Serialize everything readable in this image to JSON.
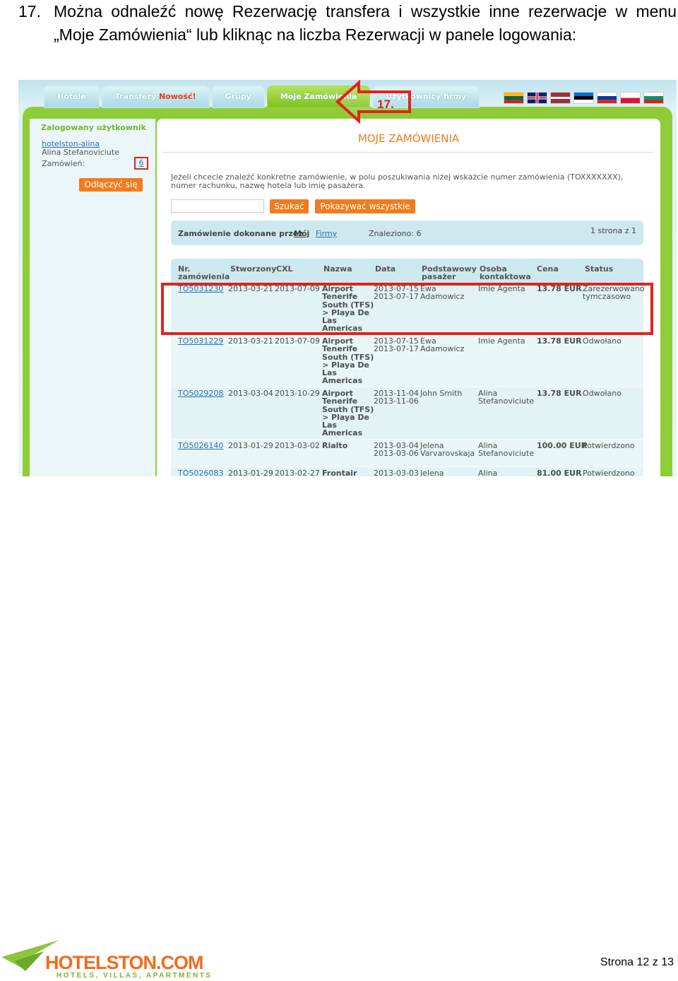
{
  "heading": {
    "number": "17.",
    "text": "Można odnaleźć nowę Rezerwację transfera i wszystkie inne rezerwacje w menu „Moje Zamówienia“ lub kliknąc na liczba Rezerwacji w panele logowania:"
  },
  "nav": {
    "tabs": [
      {
        "label": "Hotele"
      },
      {
        "label": "Transfery",
        "badge": "Nowość!"
      },
      {
        "label": "Grupy"
      },
      {
        "label": "Moje Zamówienia"
      },
      {
        "label": "Użytkownicy firmy"
      }
    ]
  },
  "annotation": {
    "label": "17."
  },
  "sidebar": {
    "title": "Zalogowany użytkownik",
    "username": "hotelston-alina",
    "full_name": "Alina Stefanoviciute",
    "orders_label": "Zamówień:",
    "orders_count": "6",
    "logout_label": "Odłączyć się"
  },
  "main": {
    "title": "MOJE ZAMÓWIENIA",
    "info": "Jeżeli chcecie znaleźć konkretne zamówienie, w polu poszukiwania niżej wskażcie numer zamówienia (TOXXXXXXX), numer rachunku, nazwę hotela lub imię pasażera.",
    "search_button": "Szukać",
    "show_all_button": "Pokazywać wszystkie",
    "filter": {
      "label": "Zamówienie dokonane przez",
      "my": "Mój",
      "firms": "Firmy",
      "found": "Znaleziono: 6",
      "page": "1 strona z 1"
    }
  },
  "table": {
    "headers": {
      "nr": "Nr.\nzamówienia",
      "created": "Stworzony",
      "cxl": "CXL",
      "name": "Nazwa",
      "date": "Data",
      "pax": "Podstawowy\npasażer",
      "contact": "Osoba\nkontaktowa",
      "price": "Cena",
      "status": "Status"
    },
    "rows": [
      {
        "nr": "TO5031230",
        "created": "2013-03-21",
        "cxl": "2013-07-09",
        "name": "Airport\nTenerife\nSouth (TFS)\n> Playa De\nLas\nAmericas",
        "date": "2013-07-15\n2013-07-17",
        "pax": "Ewa\nAdamowicz",
        "contact": "Imie Agenta",
        "price": "13.78 EUR",
        "status": "Zarezerwowano\ntymczasowo"
      },
      {
        "nr": "TO5031229",
        "created": "2013-03-21",
        "cxl": "2013-07-09",
        "name": "Airport\nTenerife\nSouth (TFS)\n> Playa De\nLas\nAmericas",
        "date": "2013-07-15\n2013-07-17",
        "pax": "Ewa\nAdamowicz",
        "contact": "Imie Agenta",
        "price": "13.78 EUR",
        "status": "Odwołano"
      },
      {
        "nr": "TO5029208",
        "created": "2013-03-04",
        "cxl": "2013-10-29",
        "name": "Airport\nTenerife\nSouth (TFS)\n> Playa De\nLas\nAmericas",
        "date": "2013-11-04\n2013-11-06",
        "pax": "John Smith",
        "contact": "Alina\nStefanoviciute",
        "price": "13.78 EUR",
        "status": "Odwołano"
      },
      {
        "nr": "TO5026140",
        "created": "2013-01-29",
        "cxl": "2013-03-02",
        "name": "Rialto",
        "date": "2013-03-04\n2013-03-06",
        "pax": "Jelena\nVarvarovskaja",
        "contact": "Alina\nStefanoviciute",
        "price": "100.00 EUR",
        "status": "Potwierdzono"
      },
      {
        "nr": "TO5026083",
        "created": "2013-01-29",
        "cxl": "2013-02-27",
        "name": "Frontair",
        "date": "2013-03-03",
        "pax": "Jelena",
        "contact": "Alina",
        "price": "81.00 EUR",
        "status": "Potwierdzono"
      }
    ]
  },
  "footer": {
    "logo": "HOTELSTON.COM",
    "logo_sub": "HOTELS, VILLAS, APARTMENTS",
    "page": "Strona 12 z 13"
  },
  "colors": {
    "accent_orange": "#f27b1d",
    "accent_green": "#8fcd38",
    "highlight_red": "#e2231a"
  }
}
